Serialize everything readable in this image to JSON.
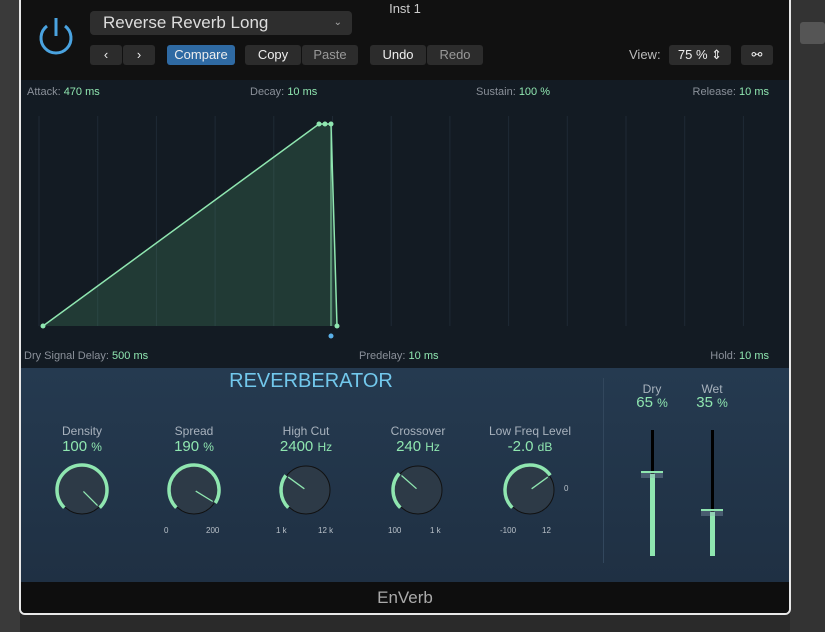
{
  "window": {
    "title": "Inst 1"
  },
  "header": {
    "preset": "Reverse Reverb Long",
    "compare": "Compare",
    "copy": "Copy",
    "paste": "Paste",
    "undo": "Undo",
    "redo": "Redo",
    "view_label": "View:",
    "view_value": "75 %"
  },
  "envelope": {
    "attack": {
      "label": "Attack:",
      "value": "470 ms"
    },
    "decay": {
      "label": "Decay:",
      "value": "10 ms"
    },
    "sustain": {
      "label": "Sustain:",
      "value": "100 %"
    },
    "release": {
      "label": "Release:",
      "value": "10 ms"
    },
    "dry_delay": {
      "label": "Dry Signal Delay:",
      "value": "500 ms"
    },
    "predelay": {
      "label": "Predelay:",
      "value": "10 ms"
    },
    "hold": {
      "label": "Hold:",
      "value": "10 ms"
    }
  },
  "reverberator": {
    "title": "REVERBERATOR",
    "knobs": [
      {
        "label": "Density",
        "value": "100",
        "unit": "%",
        "level": 1.0,
        "min": "",
        "max": ""
      },
      {
        "label": "Spread",
        "value": "190",
        "unit": "%",
        "level": 0.95,
        "min": "0",
        "max": "200"
      },
      {
        "label": "High Cut",
        "value": "2400",
        "unit": "Hz",
        "level": 0.3,
        "min": "1 k",
        "max": "12 k"
      },
      {
        "label": "Crossover",
        "value": "240",
        "unit": "Hz",
        "level": 0.32,
        "min": "100",
        "max": "1 k"
      },
      {
        "label": "Low Freq Level",
        "value": "-2.0",
        "unit": "dB",
        "level": 0.7,
        "min": "-100",
        "max": "12",
        "mid": "0"
      }
    ],
    "faders": [
      {
        "label": "Dry",
        "value": "65",
        "unit": "%",
        "level": 0.65
      },
      {
        "label": "Wet",
        "value": "35",
        "unit": "%",
        "level": 0.35
      }
    ]
  },
  "footer": {
    "name": "EnVerb"
  },
  "colors": {
    "accent": "#8fe6b0",
    "blue": "#72c8ec",
    "compare": "#2f6aa3"
  }
}
